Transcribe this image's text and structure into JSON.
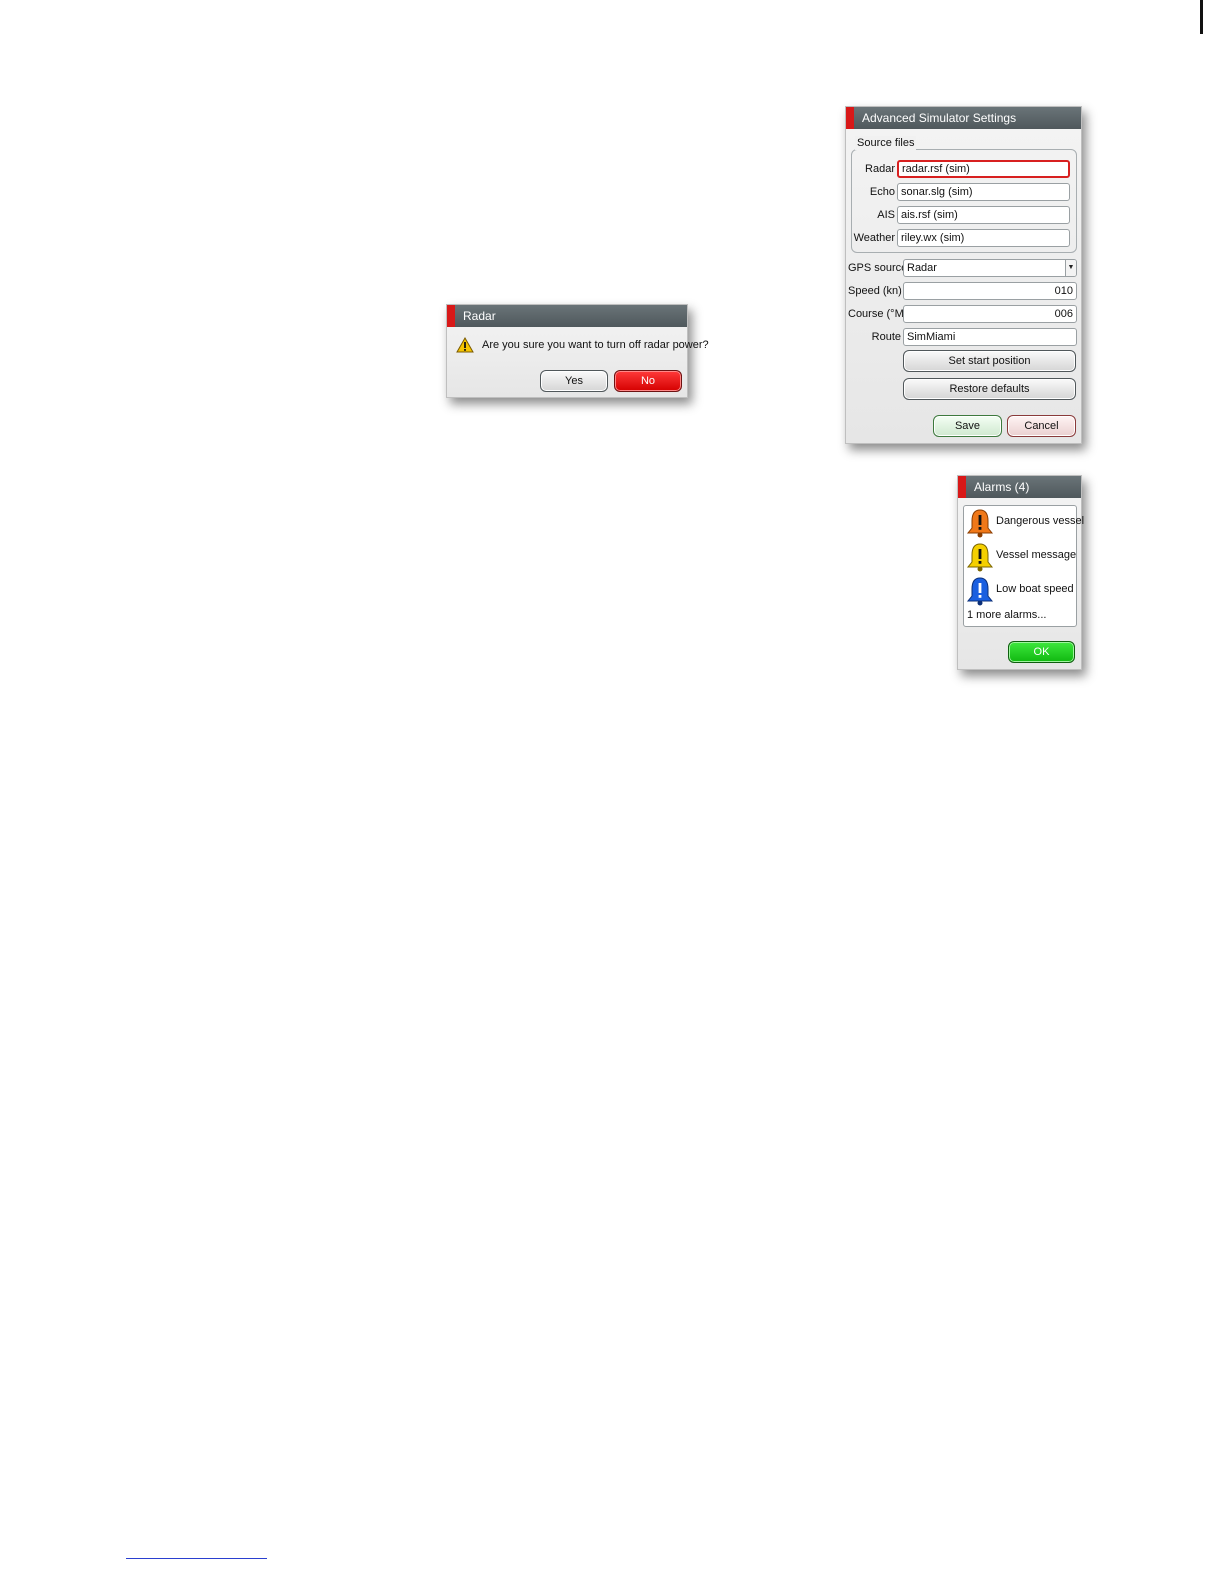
{
  "radar_dialog": {
    "title": "Radar",
    "message": "Are you sure you want to turn off radar power?",
    "icon": "warning-icon",
    "yes_label": "Yes",
    "no_label": "No"
  },
  "simulator_dialog": {
    "title": "Advanced Simulator Settings",
    "source_files_legend": "Source files",
    "source_files": [
      {
        "label": "Radar",
        "value": "radar.rsf (sim)"
      },
      {
        "label": "Echo",
        "value": "sonar.slg (sim)"
      },
      {
        "label": "AIS",
        "value": "ais.rsf (sim)"
      },
      {
        "label": "Weather",
        "value": "riley.wx (sim)"
      }
    ],
    "gps_source": {
      "label": "GPS source",
      "value": "Radar"
    },
    "speed": {
      "label": "Speed (kn)",
      "value": "010"
    },
    "course": {
      "label": "Course (°M)",
      "value": "006"
    },
    "route": {
      "label": "Route",
      "value": "SimMiami"
    },
    "set_start_label": "Set start position",
    "restore_label": "Restore defaults",
    "save_label": "Save",
    "cancel_label": "Cancel"
  },
  "alarms_dialog": {
    "title": "Alarms (4)",
    "alarms": [
      {
        "text": "Dangerous vessel",
        "icon": "orange-alarm-bell-icon",
        "color": "#f07818"
      },
      {
        "text": "Vessel message",
        "icon": "yellow-alarm-bell-icon",
        "color": "#f5d000"
      },
      {
        "text": "Low boat speed",
        "icon": "blue-alarm-bell-icon",
        "color": "#1a5fe0"
      }
    ],
    "more_text": "1 more alarms...",
    "ok_label": "OK"
  },
  "colors": {
    "title_accent": "#d81818",
    "titlebar": "#5a6367",
    "ok_green": "#22cc22",
    "no_red": "#e81010"
  }
}
